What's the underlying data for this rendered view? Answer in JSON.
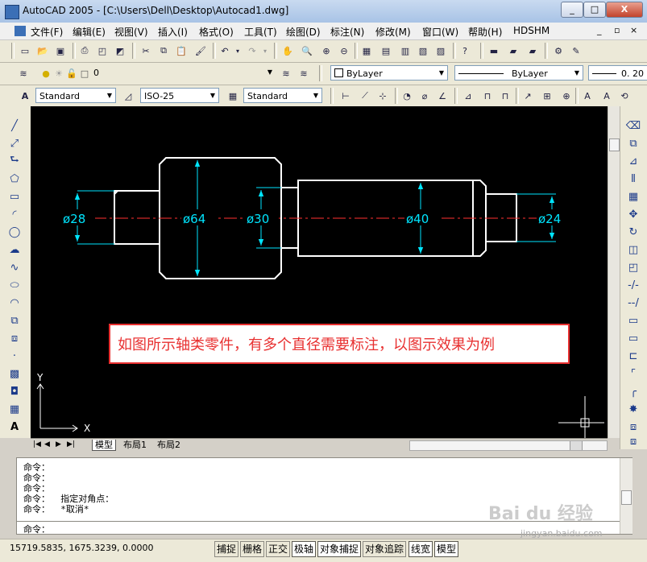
{
  "app": {
    "title": "AutoCAD 2005 - [C:\\Users\\Dell\\Desktop\\Autocad1.dwg]",
    "window_controls": [
      "_",
      "□",
      "X"
    ],
    "doc_controls": [
      "_",
      "▫",
      "×"
    ]
  },
  "menu": [
    "文件(F)",
    "编辑(E)",
    "视图(V)",
    "插入(I)",
    "格式(O)",
    "工具(T)",
    "绘图(D)",
    "标注(N)",
    "修改(M)",
    "窗口(W)",
    "帮助(H)",
    "HDSHM"
  ],
  "layers": {
    "current_layer": "0",
    "color": "ByLayer",
    "linetype": "ByLayer",
    "lineweight": "0. 20"
  },
  "styles": {
    "text_style": "Standard",
    "dim_style": "ISO-25",
    "table_style": "Standard"
  },
  "drawing": {
    "dimensions": [
      "ø28",
      "ø64",
      "ø30",
      "ø40",
      "ø24"
    ],
    "annotation": "如图所示轴类零件，有多个直径需要标注，以图示效果为例",
    "ucs_x": "X",
    "ucs_y": "Y",
    "colors": {
      "canvas": "#000000",
      "outline": "#ffffff",
      "dimension": "#00e5ff",
      "centerline": "#ff3030",
      "annotation": "#e83030"
    }
  },
  "tabs": {
    "active": "模型",
    "items": [
      "模型",
      "布局1",
      "布局2"
    ]
  },
  "command_history": [
    "命令：",
    "命令：",
    "命令：",
    "命令：  指定对角点：",
    "命令：  *取消*",
    "",
    "命令："
  ],
  "status": {
    "coords": "15719.5835,  1675.3239,  0.0000",
    "toggles": [
      {
        "label": "捕捉",
        "on": false
      },
      {
        "label": "栅格",
        "on": false
      },
      {
        "label": "正交",
        "on": false
      },
      {
        "label": "极轴",
        "on": true
      },
      {
        "label": "对象捕捉",
        "on": true
      },
      {
        "label": "对象追踪",
        "on": false
      },
      {
        "label": "线宽",
        "on": true
      },
      {
        "label": "模型",
        "on": true
      }
    ]
  },
  "watermark": {
    "brand": "Bai du 经验",
    "url": "jingyan.baidu.com"
  }
}
